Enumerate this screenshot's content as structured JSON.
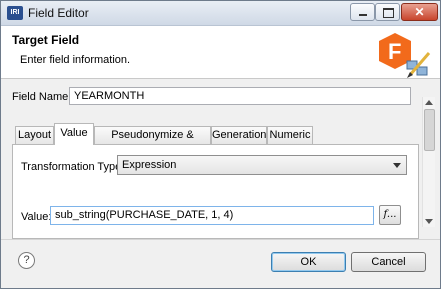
{
  "window": {
    "title": "Field Editor",
    "app_icon": "IRI"
  },
  "header": {
    "title": "Target Field",
    "subtitle": "Enter field information."
  },
  "field_name": {
    "label": "Field Name:",
    "value": "YEARMONTH"
  },
  "tabs": [
    {
      "label": "Layout"
    },
    {
      "label": "Value"
    },
    {
      "label": "Pseudonymize & Restore"
    },
    {
      "label": "Generation"
    },
    {
      "label": "Numeric"
    }
  ],
  "value_tab": {
    "transformation_type_label": "Transformation Type:",
    "transformation_type_value": "Expression",
    "value_label": "Value:",
    "value_text": "sub_string(PURCHASE_DATE, 1, 4)",
    "fx_label": "f..."
  },
  "footer": {
    "help": "?",
    "ok_label": "OK",
    "cancel_label": "Cancel"
  }
}
